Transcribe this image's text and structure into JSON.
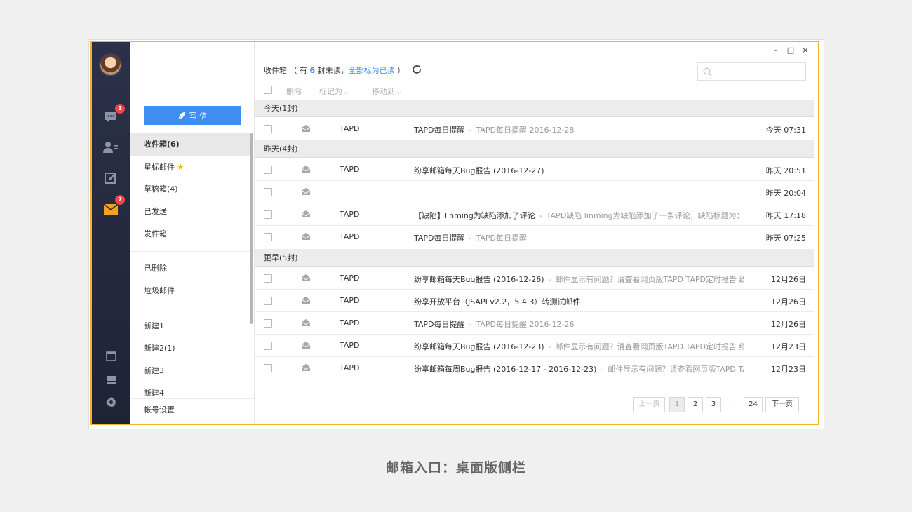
{
  "window": {
    "minimize": "–",
    "maximize": "□",
    "close": "×"
  },
  "rail": {
    "badges": {
      "chat": "1",
      "mail": "7"
    },
    "icons": [
      "chat-icon",
      "contacts-icon",
      "note-icon",
      "mail-icon",
      "window-icon",
      "drive-icon",
      "gear-icon"
    ]
  },
  "compose": {
    "label": "写 信"
  },
  "folders": [
    {
      "label": "收件箱(6)"
    },
    {
      "label": "星标邮件"
    },
    {
      "label": "草稿箱(4)"
    },
    {
      "label": "已发送"
    },
    {
      "label": "发件箱"
    },
    {
      "label": "已删除"
    },
    {
      "label": "垃圾邮件"
    },
    {
      "label": "新建1"
    },
    {
      "label": "新建2(1)"
    },
    {
      "label": "新建3"
    },
    {
      "label": "新建4"
    }
  ],
  "account_settings": "帐号设置",
  "header": {
    "folder": "收件箱",
    "unread_pre": "（ 有",
    "unread_count": "6",
    "unread_post": "封未读，",
    "mark_all": "全部标为已读",
    "close_paren": "）"
  },
  "toolbar": {
    "delete": "删除",
    "mark_as": "标记为",
    "move_to": "移动到"
  },
  "groups": {
    "today": "今天(1封)",
    "yesterday": "昨天(4封)",
    "earlier": "更早(5封)"
  },
  "emails": [
    {
      "from": "TAPD",
      "subject": "TAPD每日提醒",
      "sep": "-",
      "snippet": "TAPD每日提醒 2016-12-28",
      "time": "今天 07:31"
    },
    {
      "from": "TAPD",
      "subject": "纷享邮箱每天Bug报告 (2016-12-27)",
      "sep": "",
      "snippet": "",
      "time": "昨天 20:51"
    },
    {
      "from": "",
      "subject": "",
      "sep": "",
      "snippet": "",
      "time": "昨天 20:04"
    },
    {
      "from": "TAPD",
      "subject": "【缺陷】linming为缺陷添加了评论",
      "sep": "-",
      "snippet": "TAPD缺陷 linming为缺陷添加了一条评论，缺陷标题为：【s...",
      "time": "昨天 17:18"
    },
    {
      "from": "TAPD",
      "subject": "TAPD每日提醒",
      "sep": "-",
      "snippet": "TAPD每日提醒",
      "time": "昨天 07:25"
    },
    {
      "from": "TAPD",
      "subject": "纷享邮箱每天Bug报告 (2016-12-26)",
      "sep": "-",
      "snippet": "邮件显示有问题？请查看网页版TAPD TAPD定时报告 纷享...",
      "time": "12月26日"
    },
    {
      "from": "TAPD",
      "subject": "纷享开放平台（JSAPI v2.2，5.4.3）转测试邮件",
      "sep": "",
      "snippet": "",
      "time": "12月26日"
    },
    {
      "from": "TAPD",
      "subject": "TAPD每日提醒",
      "sep": "-",
      "snippet": "TAPD每日提醒 2016-12-26",
      "time": "12月26日"
    },
    {
      "from": "TAPD",
      "subject": "纷享邮箱每天Bug报告 (2016-12-23)",
      "sep": "-",
      "snippet": "邮件显示有问题？请查看网页版TAPD TAPD定时报告 纷享...",
      "time": "12月23日"
    },
    {
      "from": "TAPD",
      "subject": "纷享邮箱每周Bug报告 (2016-12-17 - 2016-12-23)",
      "sep": "-",
      "snippet": "邮件显示有问题？请查看网页版TAPD TAPD...",
      "time": "12月23日"
    }
  ],
  "pagination": {
    "prev": "上一页",
    "pages": [
      "1",
      "2",
      "3"
    ],
    "ellipsis": "...",
    "last": "24",
    "next": "下一页"
  },
  "caption": "邮箱入口：桌面版侧栏"
}
